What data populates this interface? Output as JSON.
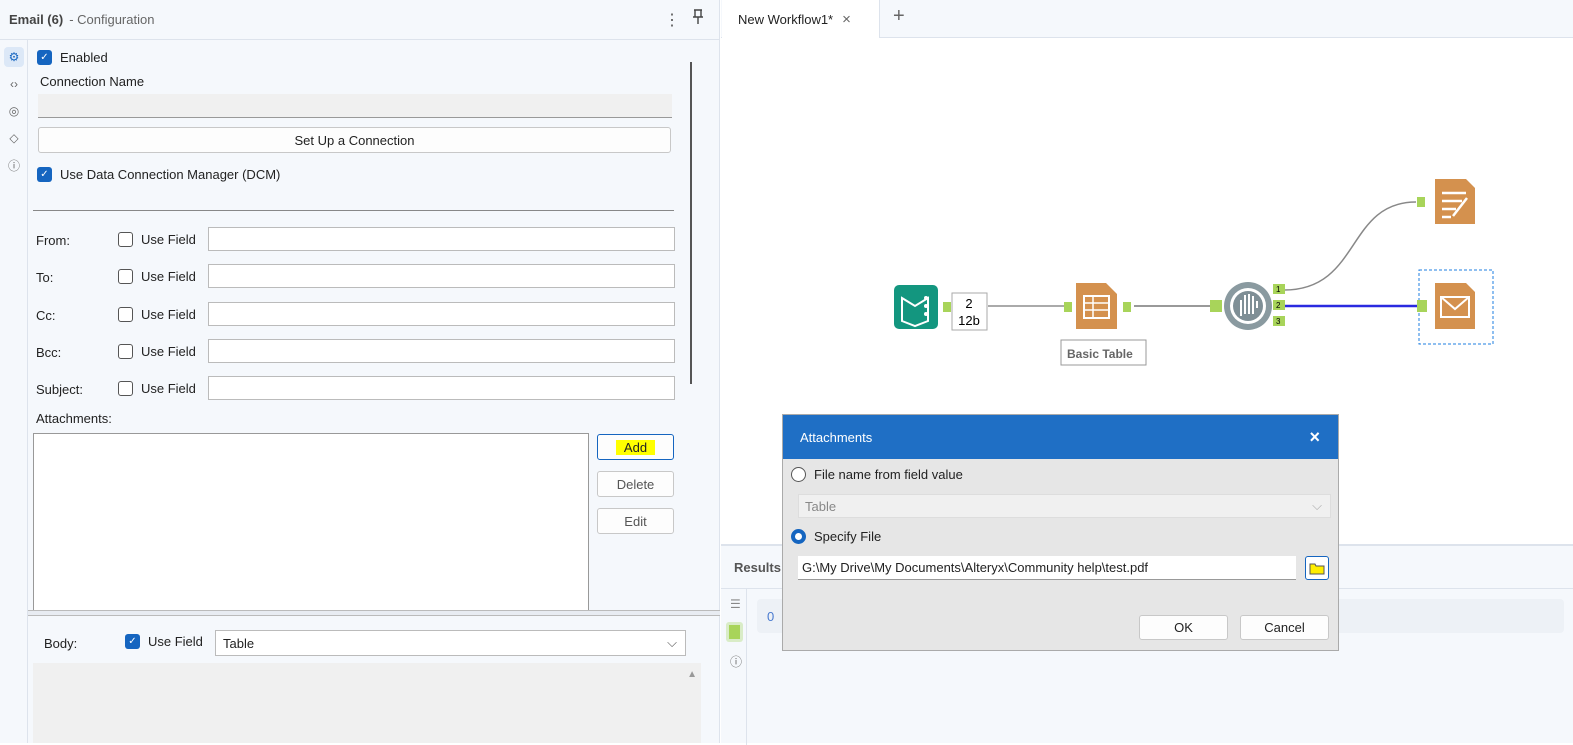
{
  "config": {
    "title": "Email (6)",
    "subtitle": "- Configuration",
    "more_icon": "⋮",
    "pin_icon": "pin"
  },
  "sidebar": [
    "gear-icon",
    "code-icon",
    "arrow-circle-icon",
    "tag-icon",
    "help-icon"
  ],
  "form": {
    "enabled": "Enabled",
    "connection_name": "Connection Name",
    "setup_button": "Set Up a Connection",
    "dcm": "Use Data Connection Manager (DCM)",
    "fields": [
      {
        "label": "From:",
        "use_field": "Use Field"
      },
      {
        "label": "To:",
        "use_field": "Use Field"
      },
      {
        "label": "Cc:",
        "use_field": "Use Field"
      },
      {
        "label": "Bcc:",
        "use_field": "Use Field"
      },
      {
        "label": "Subject:",
        "use_field": "Use Field"
      }
    ],
    "attachments": "Attachments:",
    "add": "Add",
    "delete": "Delete",
    "edit": "Edit",
    "body": "Body:",
    "body_use_field": "Use Field",
    "body_value": "Table"
  },
  "workflow": {
    "tab": "New Workflow1*",
    "close": "×",
    "new_tab": "+",
    "count_top": "2",
    "count_bottom": "12b",
    "basic_table_label": "Basic Table",
    "anchors": [
      "1",
      "2",
      "3"
    ]
  },
  "results": {
    "label": "Results",
    "row_num": "0"
  },
  "dialog": {
    "title": "Attachments",
    "close": "×",
    "opt1": "File name from field value",
    "field_select": "Table",
    "opt2": "Specify File",
    "path": "G:\\My Drive\\My Documents\\Alteryx\\Community help\\test.pdf",
    "ok": "OK",
    "cancel": "Cancel"
  },
  "colors": {
    "accent": "#1565c0",
    "dialog_title": "#1f6fc5",
    "tool_orange": "#d4914e",
    "input_teal": "#13967f",
    "anchor_green": "#a8d45a",
    "highlight": "#ffff00"
  }
}
